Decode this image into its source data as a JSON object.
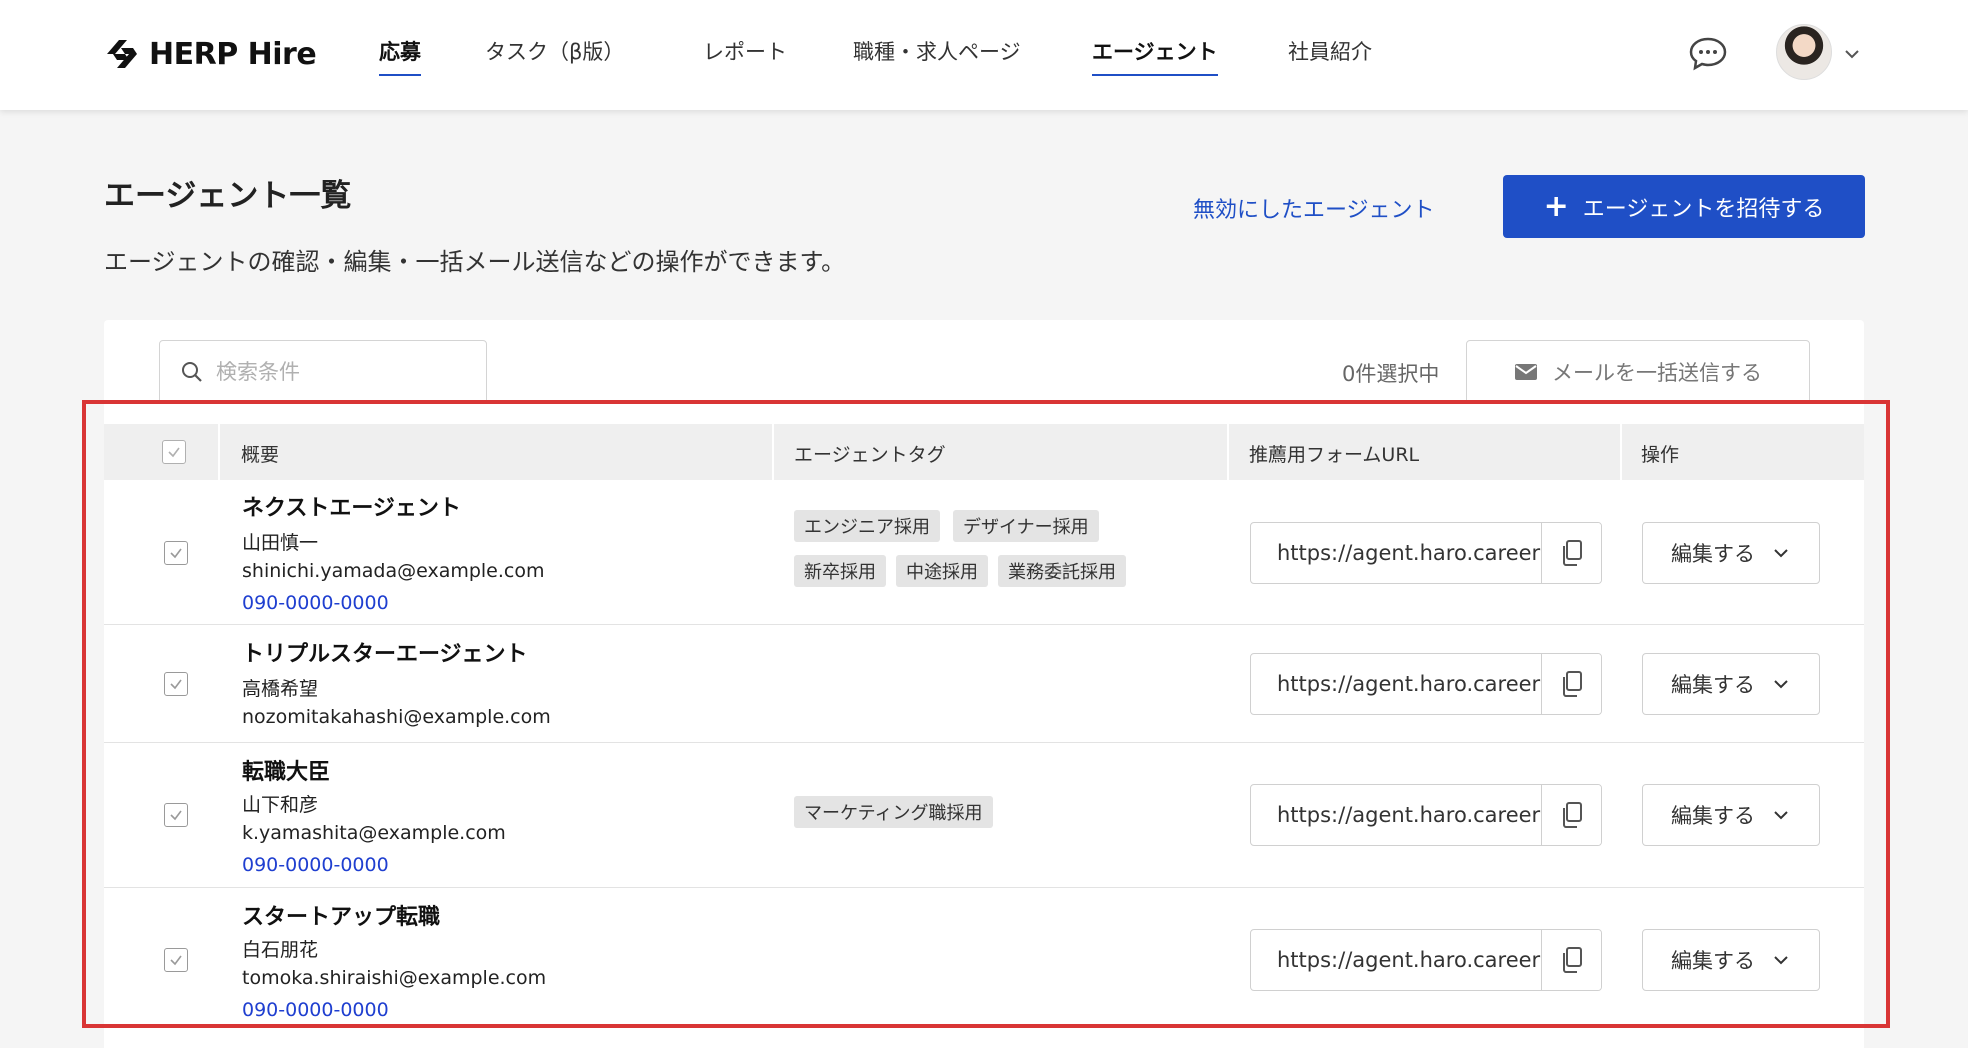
{
  "header": {
    "logo_text": "HERP Hire",
    "nav": [
      {
        "label": "応募",
        "active": true
      },
      {
        "label": "タスク（β版）",
        "active": false
      },
      {
        "label": "レポート",
        "active": false
      },
      {
        "label": "職種・求人ページ",
        "active": false
      },
      {
        "label": "エージェント",
        "active": true
      },
      {
        "label": "社員紹介",
        "active": false
      }
    ]
  },
  "page": {
    "title": "エージェント一覧",
    "description": "エージェントの確認・編集・一括メール送信などの操作ができます。",
    "disabled_agents_link": "無効にしたエージェント",
    "invite_button": "エージェントを招待する"
  },
  "toolbar": {
    "search_placeholder": "検索条件",
    "selected_count": "0件選択中",
    "bulk_mail_button": "メールを一括送信する"
  },
  "table": {
    "headers": {
      "summary": "概要",
      "tags": "エージェントタグ",
      "form_url": "推薦用フォームURL",
      "actions": "操作"
    },
    "rows": [
      {
        "name": "ネクストエージェント",
        "person": "山田慎一",
        "email": "shinichi.yamada@example.com",
        "phone": "090-0000-0000",
        "tags": [
          "エンジニア採用",
          "デザイナー採用",
          "新卒採用",
          "中途採用",
          "業務委託採用"
        ],
        "url": "https://agent.haro.careers",
        "edit_label": "編集する"
      },
      {
        "name": "トリプルスターエージェント",
        "person": "高橋希望",
        "email": "nozomitakahashi@example.com",
        "phone": "",
        "tags": [],
        "url": "https://agent.haro.careers",
        "edit_label": "編集する"
      },
      {
        "name": "転職大臣",
        "person": "山下和彦",
        "email": "k.yamashita@example.com",
        "phone": "090-0000-0000",
        "tags": [
          "マーケティング職採用"
        ],
        "url": "https://agent.haro.careers",
        "edit_label": "編集する"
      },
      {
        "name": "スタートアップ転職",
        "person": "白石朋花",
        "email": "tomoka.shiraishi@example.com",
        "phone": "090-0000-0000",
        "tags": [],
        "url": "https://agent.haro.careers",
        "edit_label": "編集する"
      }
    ]
  },
  "colors": {
    "accent": "#1f4fc6",
    "phone_link": "#1f3fd0",
    "highlight": "#d93535"
  },
  "icons": {
    "chat": "chat-bubble-icon",
    "search": "search-icon",
    "mail": "mail-icon",
    "copy": "copy-icon",
    "chevron": "chevron-down-icon"
  }
}
